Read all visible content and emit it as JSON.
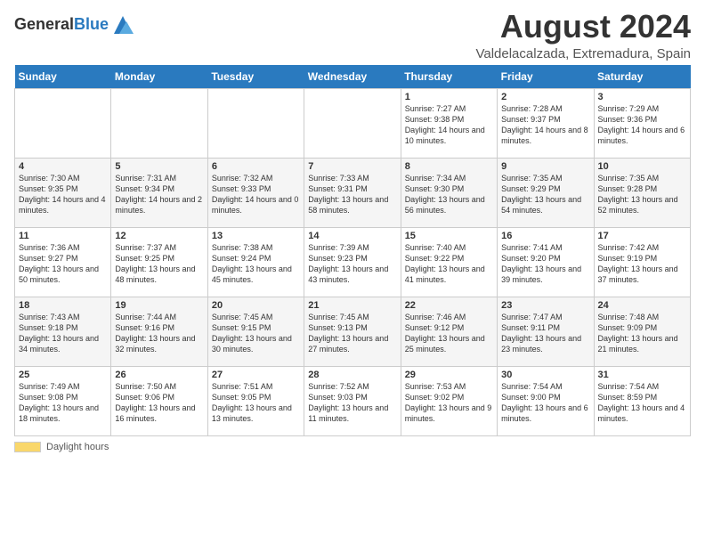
{
  "header": {
    "logo_general": "General",
    "logo_blue": "Blue",
    "title": "August 2024",
    "subtitle": "Valdelacalzada, Extremadura, Spain"
  },
  "days_of_week": [
    "Sunday",
    "Monday",
    "Tuesday",
    "Wednesday",
    "Thursday",
    "Friday",
    "Saturday"
  ],
  "weeks": [
    {
      "cells": [
        {
          "day": "",
          "content": ""
        },
        {
          "day": "",
          "content": ""
        },
        {
          "day": "",
          "content": ""
        },
        {
          "day": "",
          "content": ""
        },
        {
          "day": "1",
          "content": "Sunrise: 7:27 AM\nSunset: 9:38 PM\nDaylight: 14 hours\nand 10 minutes."
        },
        {
          "day": "2",
          "content": "Sunrise: 7:28 AM\nSunset: 9:37 PM\nDaylight: 14 hours\nand 8 minutes."
        },
        {
          "day": "3",
          "content": "Sunrise: 7:29 AM\nSunset: 9:36 PM\nDaylight: 14 hours\nand 6 minutes."
        }
      ]
    },
    {
      "cells": [
        {
          "day": "4",
          "content": "Sunrise: 7:30 AM\nSunset: 9:35 PM\nDaylight: 14 hours\nand 4 minutes."
        },
        {
          "day": "5",
          "content": "Sunrise: 7:31 AM\nSunset: 9:34 PM\nDaylight: 14 hours\nand 2 minutes."
        },
        {
          "day": "6",
          "content": "Sunrise: 7:32 AM\nSunset: 9:33 PM\nDaylight: 14 hours\nand 0 minutes."
        },
        {
          "day": "7",
          "content": "Sunrise: 7:33 AM\nSunset: 9:31 PM\nDaylight: 13 hours\nand 58 minutes."
        },
        {
          "day": "8",
          "content": "Sunrise: 7:34 AM\nSunset: 9:30 PM\nDaylight: 13 hours\nand 56 minutes."
        },
        {
          "day": "9",
          "content": "Sunrise: 7:35 AM\nSunset: 9:29 PM\nDaylight: 13 hours\nand 54 minutes."
        },
        {
          "day": "10",
          "content": "Sunrise: 7:35 AM\nSunset: 9:28 PM\nDaylight: 13 hours\nand 52 minutes."
        }
      ]
    },
    {
      "cells": [
        {
          "day": "11",
          "content": "Sunrise: 7:36 AM\nSunset: 9:27 PM\nDaylight: 13 hours\nand 50 minutes."
        },
        {
          "day": "12",
          "content": "Sunrise: 7:37 AM\nSunset: 9:25 PM\nDaylight: 13 hours\nand 48 minutes."
        },
        {
          "day": "13",
          "content": "Sunrise: 7:38 AM\nSunset: 9:24 PM\nDaylight: 13 hours\nand 45 minutes."
        },
        {
          "day": "14",
          "content": "Sunrise: 7:39 AM\nSunset: 9:23 PM\nDaylight: 13 hours\nand 43 minutes."
        },
        {
          "day": "15",
          "content": "Sunrise: 7:40 AM\nSunset: 9:22 PM\nDaylight: 13 hours\nand 41 minutes."
        },
        {
          "day": "16",
          "content": "Sunrise: 7:41 AM\nSunset: 9:20 PM\nDaylight: 13 hours\nand 39 minutes."
        },
        {
          "day": "17",
          "content": "Sunrise: 7:42 AM\nSunset: 9:19 PM\nDaylight: 13 hours\nand 37 minutes."
        }
      ]
    },
    {
      "cells": [
        {
          "day": "18",
          "content": "Sunrise: 7:43 AM\nSunset: 9:18 PM\nDaylight: 13 hours\nand 34 minutes."
        },
        {
          "day": "19",
          "content": "Sunrise: 7:44 AM\nSunset: 9:16 PM\nDaylight: 13 hours\nand 32 minutes."
        },
        {
          "day": "20",
          "content": "Sunrise: 7:45 AM\nSunset: 9:15 PM\nDaylight: 13 hours\nand 30 minutes."
        },
        {
          "day": "21",
          "content": "Sunrise: 7:45 AM\nSunset: 9:13 PM\nDaylight: 13 hours\nand 27 minutes."
        },
        {
          "day": "22",
          "content": "Sunrise: 7:46 AM\nSunset: 9:12 PM\nDaylight: 13 hours\nand 25 minutes."
        },
        {
          "day": "23",
          "content": "Sunrise: 7:47 AM\nSunset: 9:11 PM\nDaylight: 13 hours\nand 23 minutes."
        },
        {
          "day": "24",
          "content": "Sunrise: 7:48 AM\nSunset: 9:09 PM\nDaylight: 13 hours\nand 21 minutes."
        }
      ]
    },
    {
      "cells": [
        {
          "day": "25",
          "content": "Sunrise: 7:49 AM\nSunset: 9:08 PM\nDaylight: 13 hours\nand 18 minutes."
        },
        {
          "day": "26",
          "content": "Sunrise: 7:50 AM\nSunset: 9:06 PM\nDaylight: 13 hours\nand 16 minutes."
        },
        {
          "day": "27",
          "content": "Sunrise: 7:51 AM\nSunset: 9:05 PM\nDaylight: 13 hours\nand 13 minutes."
        },
        {
          "day": "28",
          "content": "Sunrise: 7:52 AM\nSunset: 9:03 PM\nDaylight: 13 hours\nand 11 minutes."
        },
        {
          "day": "29",
          "content": "Sunrise: 7:53 AM\nSunset: 9:02 PM\nDaylight: 13 hours\nand 9 minutes."
        },
        {
          "day": "30",
          "content": "Sunrise: 7:54 AM\nSunset: 9:00 PM\nDaylight: 13 hours\nand 6 minutes."
        },
        {
          "day": "31",
          "content": "Sunrise: 7:54 AM\nSunset: 8:59 PM\nDaylight: 13 hours\nand 4 minutes."
        }
      ]
    }
  ],
  "footer": {
    "swatch_label": "Daylight hours"
  }
}
